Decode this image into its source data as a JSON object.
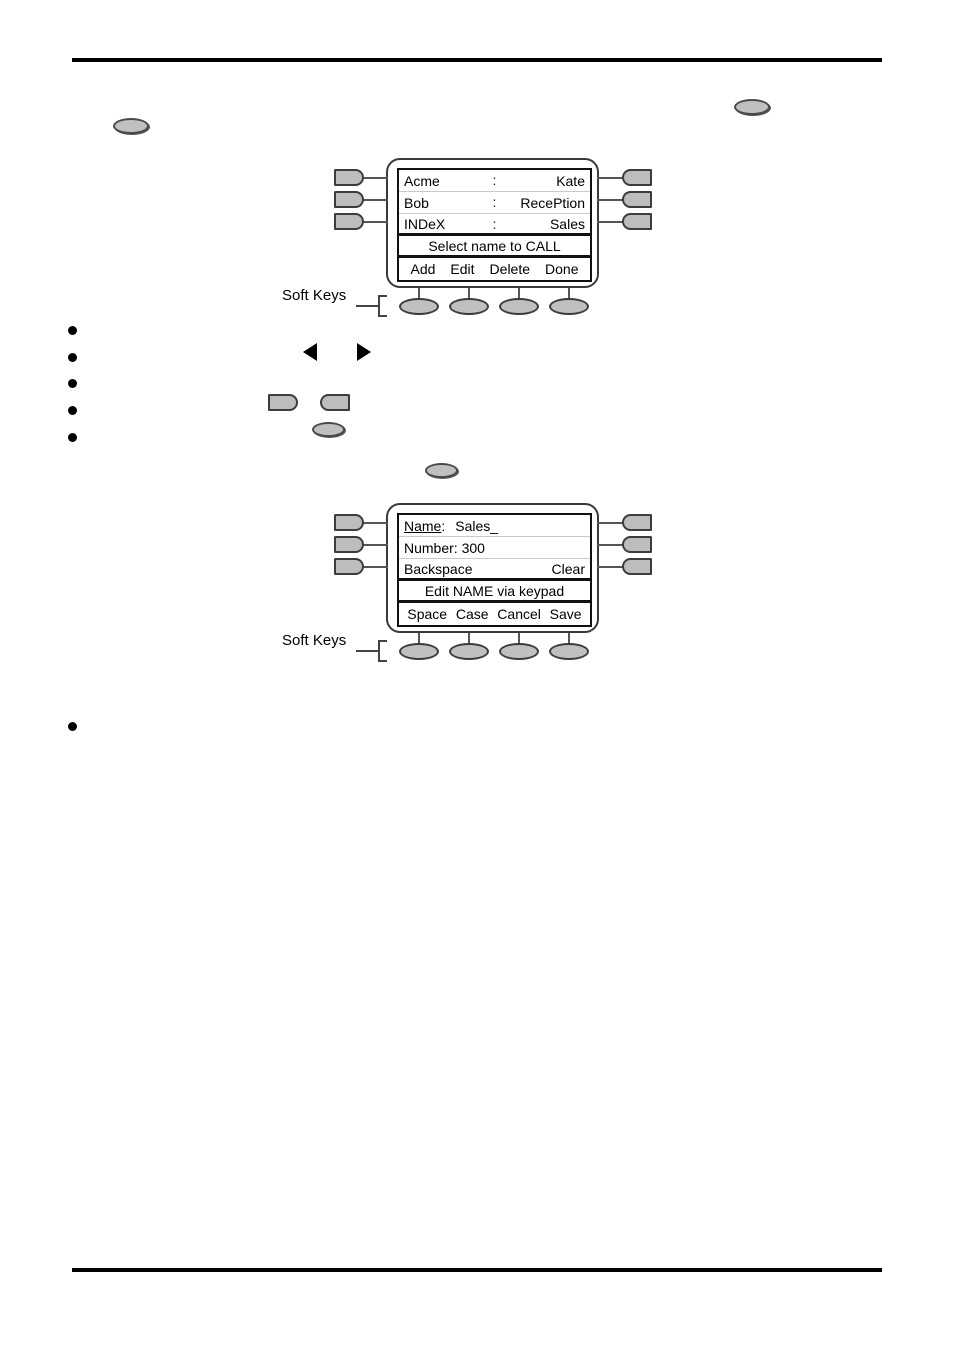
{
  "page": {
    "rules": [
      "top-rule",
      "bottom-rule"
    ]
  },
  "inline_icons": {
    "top_left_softkey": "softkey-oval-icon",
    "top_right_softkey": "softkey-oval-icon",
    "left_arrow": "left-arrow-icon",
    "right_arrow": "right-arrow-icon",
    "display_button_left": "left-display-button-icon",
    "display_button_right": "right-display-button-icon",
    "mid_softkey": "softkey-oval-icon",
    "lower_softkey": "softkey-oval-icon"
  },
  "directory_display": {
    "softkeys_label": "Soft Keys",
    "rows": [
      {
        "left": "Acme",
        "separator": ":",
        "right": "Kate"
      },
      {
        "left": "Bob",
        "separator": ":",
        "right": "RecePtion"
      },
      {
        "left": "INDeX",
        "separator": ":",
        "right": "Sales"
      }
    ],
    "prompt": "Select name to CALL",
    "softkeys": [
      "Add",
      "Edit",
      "Delete",
      "Done"
    ]
  },
  "edit_display": {
    "softkeys_label": "Soft Keys",
    "name_label": "Name",
    "name_suffix": ":",
    "name_value": "Sales_",
    "number_row": "Number: 300",
    "backspace_label": "Backspace",
    "clear_label": "Clear",
    "prompt": "Edit NAME via keypad",
    "softkeys": [
      "Space",
      "Case",
      "Cancel",
      "Save"
    ]
  },
  "colors": {
    "button_fill": "#bdbdbd",
    "button_stroke": "#3c3c3c",
    "rule": "#000000"
  }
}
